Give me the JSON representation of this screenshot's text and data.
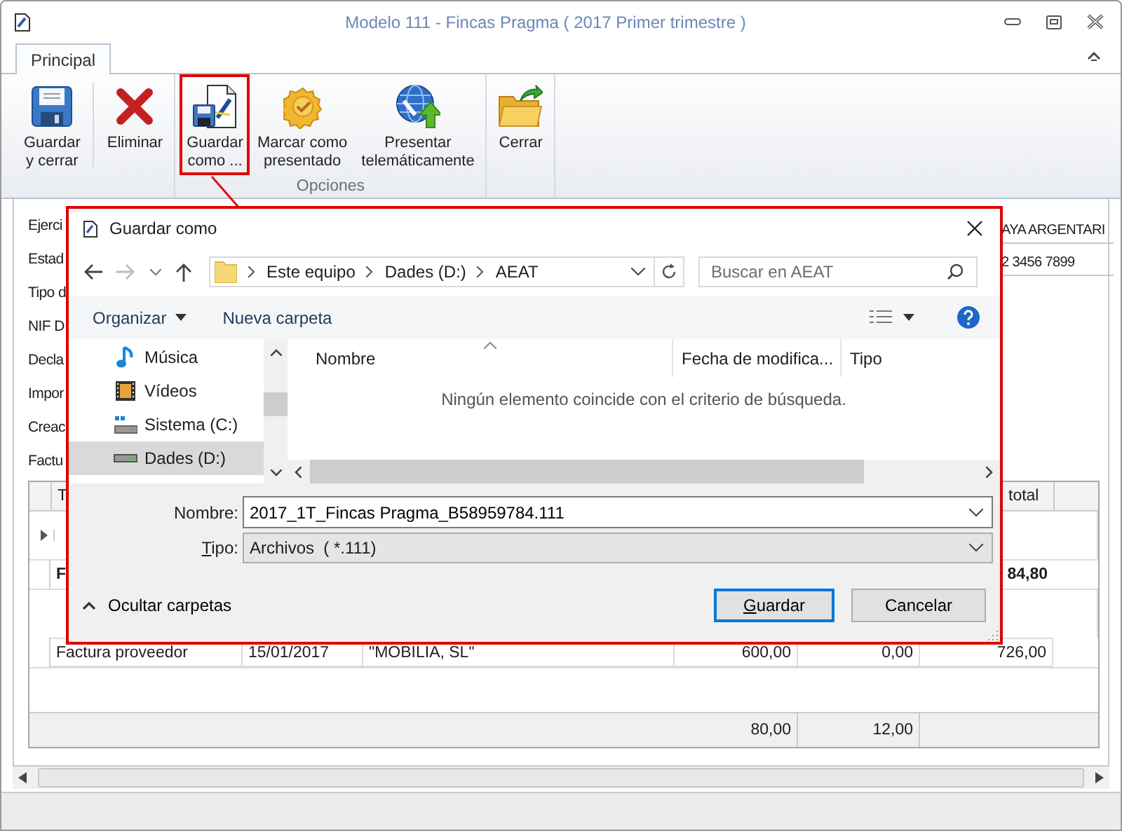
{
  "window": {
    "title": "Modelo 111 - Fincas Pragma ( 2017 Primer trimestre )"
  },
  "tabs": [
    {
      "label": "Principal",
      "selected": true
    }
  ],
  "ribbon_groups": [
    {
      "buttons": [
        {
          "lines": [
            "Guardar",
            "y cerrar"
          ],
          "kind": "save",
          "highlighted": false
        },
        {
          "lines": [
            "Eliminar"
          ],
          "kind": "delete",
          "highlighted": false
        }
      ]
    },
    {
      "label": "Opciones",
      "buttons": [
        {
          "lines": [
            "Guardar",
            "como ..."
          ],
          "kind": "save-as",
          "highlighted": true
        },
        {
          "lines": [
            "Marcar como",
            "presentado"
          ],
          "kind": "mark",
          "highlighted": false
        },
        {
          "lines": [
            "Presentar",
            "telemáticamente"
          ],
          "kind": "send",
          "highlighted": false
        }
      ]
    },
    {
      "buttons": [
        {
          "lines": [
            "Cerrar"
          ],
          "kind": "close",
          "highlighted": false
        }
      ]
    }
  ],
  "form": {
    "labels": [
      "Ejerci",
      "Estad",
      "Tipo d",
      "NIF D",
      "Decla",
      "Impor",
      "Creac",
      "Factu"
    ],
    "values": [
      "AYA ARGENTARI",
      "2 3456 7899"
    ]
  },
  "table": {
    "columns": [
      "T",
      null,
      null,
      null,
      null,
      "total",
      null
    ],
    "rows": [
      {
        "kind": "group",
        "current": true
      },
      {
        "kind": "summary",
        "current": false,
        "cells": [
          "F",
          null,
          null,
          null,
          null,
          "84,80",
          null
        ]
      },
      {
        "kind": "group",
        "current": false
      },
      {
        "kind": "data",
        "current": false,
        "cells": [
          "Factura proveedor",
          "15/01/2017",
          "\"MOBILIA, SL\"",
          "600,00",
          "0,00",
          "726,00",
          null
        ]
      }
    ],
    "totals": [
      "80,00",
      "12,00"
    ]
  },
  "dialog": {
    "title": "Guardar como",
    "breadcrumb": [
      "Este equipo",
      "Dades (D:)",
      "AEAT"
    ],
    "search": {
      "placeholder": "Buscar en AEAT"
    },
    "organize": "Organizar",
    "new_folder": "Nueva carpeta",
    "nav_items": [
      {
        "label": "Música",
        "kind": "music",
        "selected": false
      },
      {
        "label": "Vídeos",
        "kind": "video",
        "selected": false
      },
      {
        "label": "Sistema (C:)",
        "kind": "system-drive",
        "selected": false
      },
      {
        "label": "Dades (D:)",
        "kind": "drive",
        "selected": true
      }
    ],
    "columns": [
      "Nombre",
      "Fecha de modifica...",
      "Tipo"
    ],
    "empty_message": "Ningún elemento coincide con el criterio de búsqueda.",
    "filename": {
      "label": "Nombre:",
      "value": "2017_1T_Fincas Pragma_B58959784.111"
    },
    "filetype": {
      "label": "Tipo:",
      "value": "Archivos  ( *.111)"
    },
    "toggle": "Ocultar carpetas",
    "buttons": [
      {
        "label": "Guardar",
        "default": true
      },
      {
        "label": "Cancelar",
        "default": false
      }
    ]
  }
}
